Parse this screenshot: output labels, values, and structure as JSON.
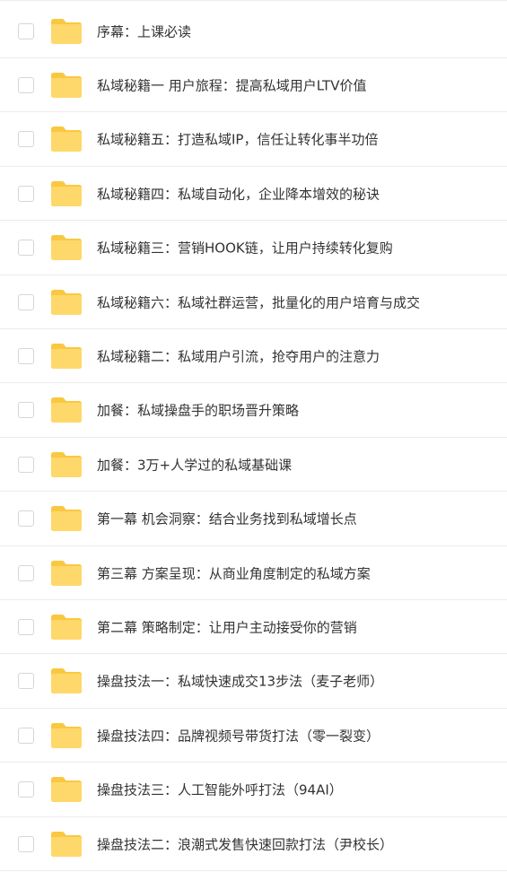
{
  "colors": {
    "folder": "#FFD86B",
    "folder_tab": "#F9C840",
    "border": "#ECECEC",
    "text": "#333333"
  },
  "file_list": {
    "items": [
      {
        "name": "序幕：上课必读",
        "icon": "folder-icon",
        "checked": false
      },
      {
        "name": "私域秘籍一 用户旅程：提高私域用户LTV价值",
        "icon": "folder-icon",
        "checked": false
      },
      {
        "name": "私域秘籍五：打造私域IP，信任让转化事半功倍",
        "icon": "folder-icon",
        "checked": false
      },
      {
        "name": "私域秘籍四：私域自动化，企业降本增效的秘诀",
        "icon": "folder-icon",
        "checked": false
      },
      {
        "name": "私域秘籍三：营销HOOK链，让用户持续转化复购",
        "icon": "folder-icon",
        "checked": false
      },
      {
        "name": "私域秘籍六：私域社群运营，批量化的用户培育与成交",
        "icon": "folder-icon",
        "checked": false
      },
      {
        "name": "私域秘籍二：私域用户引流，抢夺用户的注意力",
        "icon": "folder-icon",
        "checked": false
      },
      {
        "name": "加餐：私域操盘手的职场晋升策略",
        "icon": "folder-icon",
        "checked": false
      },
      {
        "name": "加餐：3万+人学过的私域基础课",
        "icon": "folder-icon",
        "checked": false
      },
      {
        "name": "第一幕 机会洞察：结合业务找到私域增长点",
        "icon": "folder-icon",
        "checked": false
      },
      {
        "name": "第三幕 方案呈现：从商业角度制定的私域方案",
        "icon": "folder-icon",
        "checked": false
      },
      {
        "name": "第二幕 策略制定：让用户主动接受你的营销",
        "icon": "folder-icon",
        "checked": false
      },
      {
        "name": "操盘技法一：私域快速成交13步法（麦子老师）",
        "icon": "folder-icon",
        "checked": false
      },
      {
        "name": "操盘技法四：品牌视频号带货打法（零一裂变）",
        "icon": "folder-icon",
        "checked": false
      },
      {
        "name": "操盘技法三：人工智能外呼打法（94AI）",
        "icon": "folder-icon",
        "checked": false
      },
      {
        "name": "操盘技法二：浪潮式发售快速回款打法（尹校长）",
        "icon": "folder-icon",
        "checked": false
      }
    ]
  }
}
